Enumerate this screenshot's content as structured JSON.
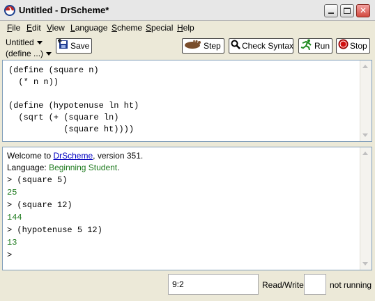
{
  "window": {
    "title": "Untitled - DrScheme*"
  },
  "menubar": {
    "items": [
      {
        "label": "File",
        "accel": "F",
        "rest": "ile"
      },
      {
        "label": "Edit",
        "accel": "E",
        "rest": "dit"
      },
      {
        "label": "View",
        "accel": "V",
        "rest": "iew"
      },
      {
        "label": "Language",
        "accel": "L",
        "rest": "anguage"
      },
      {
        "label": "Scheme",
        "accel": "S",
        "rest": "cheme"
      },
      {
        "label": "Special",
        "accel": "S",
        "rest": "pecial"
      },
      {
        "label": "Help",
        "accel": "H",
        "rest": "elp"
      }
    ]
  },
  "toolbar": {
    "doc_name": "Untitled",
    "define_menu": "(define ...)",
    "save_label": "Save",
    "step_label": "Step",
    "check_label": "Check Syntax",
    "run_label": "Run",
    "stop_label": "Stop"
  },
  "definitions": {
    "code": "(define (square n)\n  (* n n))\n\n(define (hypotenuse ln ht)\n  (sqrt (+ (square ln)\n           (square ht))))"
  },
  "repl": {
    "welcome_prefix": "Welcome to ",
    "welcome_link": "DrScheme",
    "welcome_suffix": ", version 351.",
    "language_prefix": "Language: ",
    "language_name": "Beginning Student",
    "language_suffix": ".",
    "lines": [
      {
        "prompt": ">",
        "expr": " (square 5)"
      },
      {
        "result": "25"
      },
      {
        "prompt": ">",
        "expr": " (square 12)"
      },
      {
        "result": "144"
      },
      {
        "prompt": ">",
        "expr": " (hypotenuse 5 12)"
      },
      {
        "result": "13"
      },
      {
        "prompt": ">",
        "expr": ""
      }
    ]
  },
  "statusbar": {
    "position": "9:2",
    "mode": "Read/Write",
    "state": "not running"
  },
  "colors": {
    "link": "#0000c0",
    "result_green": "#1e7a1e"
  }
}
